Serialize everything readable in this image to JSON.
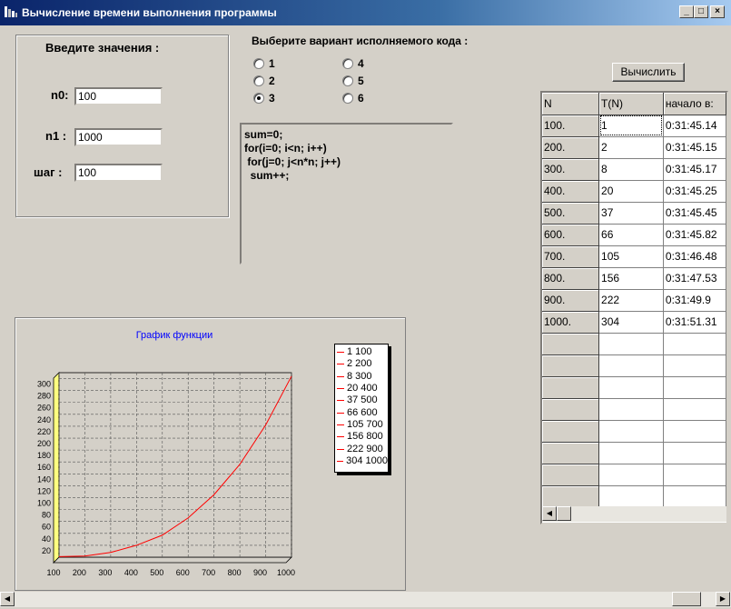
{
  "window": {
    "title": "Вычисление времени выполнения программы",
    "min": "_",
    "max": "□",
    "close": "×"
  },
  "inputs": {
    "header": "Введите  значения :",
    "n0_label": "n0:",
    "n0_value": "100",
    "n1_label": "n1 :",
    "n1_value": "1000",
    "step_label": "шаг :",
    "step_value": "100"
  },
  "variants": {
    "header": "Выберите вариант исполняемого кода :",
    "options": [
      "1",
      "2",
      "3",
      "4",
      "5",
      "6"
    ],
    "selected": "3"
  },
  "code": "sum=0;\nfor(i=0; i<n; i++)\n for(j=0; j<n*n; j++)\n  sum++;",
  "compute_button": "Вычислить",
  "table": {
    "headers": [
      "N",
      "T(N)",
      "начало в:"
    ],
    "rows": [
      [
        "100.",
        "1",
        "0:31:45.14"
      ],
      [
        "200.",
        "2",
        "0:31:45.15"
      ],
      [
        "300.",
        "8",
        "0:31:45.17"
      ],
      [
        "400.",
        "20",
        "0:31:45.25"
      ],
      [
        "500.",
        "37",
        "0:31:45.45"
      ],
      [
        "600.",
        "66",
        "0:31:45.82"
      ],
      [
        "700.",
        "105",
        "0:31:46.48"
      ],
      [
        "800.",
        "156",
        "0:31:47.53"
      ],
      [
        "900.",
        "222",
        "0:31:49.9"
      ],
      [
        "1000.",
        "304",
        "0:31:51.31"
      ]
    ],
    "empty_rows": 8
  },
  "chart_data": {
    "type": "line",
    "title": "График  функции",
    "x": [
      100,
      200,
      300,
      400,
      500,
      600,
      700,
      800,
      900,
      1000
    ],
    "series": [
      {
        "values": [
          1,
          2,
          8,
          20,
          37,
          66,
          105,
          156,
          222,
          304
        ]
      }
    ],
    "xticks": [
      "100",
      "200",
      "300",
      "400",
      "500",
      "600",
      "700",
      "800",
      "900",
      "1000"
    ],
    "yticks": [
      "20",
      "40",
      "60",
      "80",
      "100",
      "120",
      "140",
      "160",
      "180",
      "200",
      "220",
      "240",
      "260",
      "280",
      "300"
    ],
    "xlim": [
      100,
      1000
    ],
    "ylim": [
      0,
      310
    ],
    "grid": true,
    "legend": [
      "1 100",
      "2 200",
      "8 300",
      "20 400",
      "37 500",
      "66 600",
      "105 700",
      "156 800",
      "222 900",
      "304 1000"
    ],
    "legend_position": "right",
    "line_color": "#ff0000"
  }
}
